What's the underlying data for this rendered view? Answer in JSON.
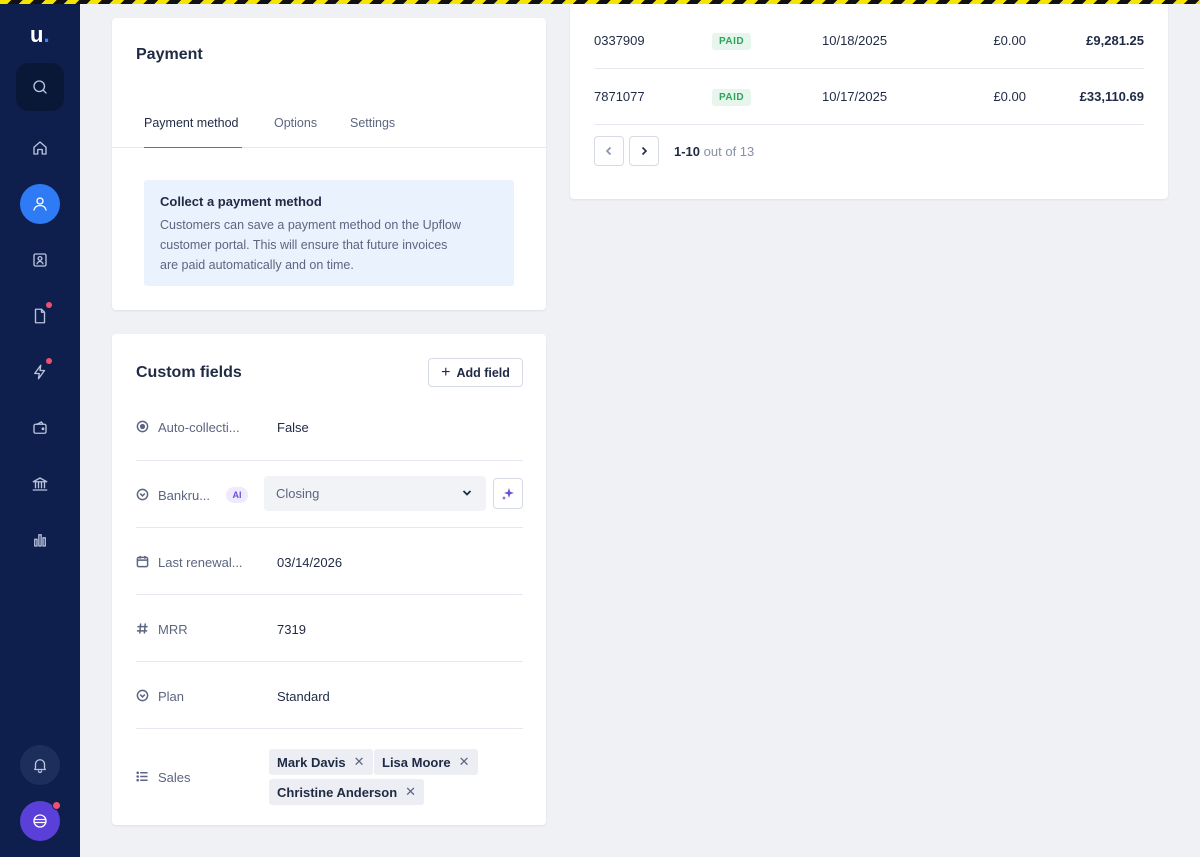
{
  "sidebar": {
    "logo": "u",
    "logo_dot": ".",
    "items": [
      "search-icon",
      "home-icon",
      "user-icon",
      "contact-card-icon",
      "document-icon",
      "lightning-icon",
      "wallet-icon",
      "bank-icon",
      "bar-chart-icon"
    ],
    "active_item": "user-icon",
    "accent_color": "#2f7bf5"
  },
  "payment": {
    "title": "Payment",
    "tabs": [
      "Payment method",
      "Options",
      "Settings"
    ],
    "active_tab": "Payment method",
    "notice_title": "Collect a payment method",
    "notice_line1": "Customers can save a payment method on the Upflow",
    "notice_line2": "customer portal. This will ensure that future invoices",
    "notice_line3": "are paid automatically and on time."
  },
  "custom_fields": {
    "title": "Custom fields",
    "add_label": "Add field",
    "fields": [
      {
        "icon": "radio-icon",
        "label": "Auto-collecti...",
        "value": "False"
      },
      {
        "icon": "dropdown-icon",
        "label": "Bankru...",
        "badge": "AI",
        "value": "Closing"
      },
      {
        "icon": "calendar-icon",
        "label": "Last renewal...",
        "value": "03/14/2026"
      },
      {
        "icon": "hash-icon",
        "label": "MRR",
        "value": "7319"
      },
      {
        "icon": "dropdown-icon",
        "label": "Plan",
        "value": "Standard"
      },
      {
        "icon": "list-icon",
        "label": "Sales",
        "chips": [
          "Mark Davis",
          "Lisa Moore",
          "Christine Anderson"
        ]
      }
    ]
  },
  "invoices": {
    "rows": [
      {
        "number": "0337909",
        "status": "PAID",
        "date": "10/18/2025",
        "outstanding": "£0.00",
        "amount": "£9,281.25"
      },
      {
        "number": "7871077",
        "status": "PAID",
        "date": "10/17/2025",
        "outstanding": "£0.00",
        "amount": "£33,110.69"
      }
    ],
    "pagination": {
      "range": "1-10",
      "total_text": "out of 13"
    }
  }
}
